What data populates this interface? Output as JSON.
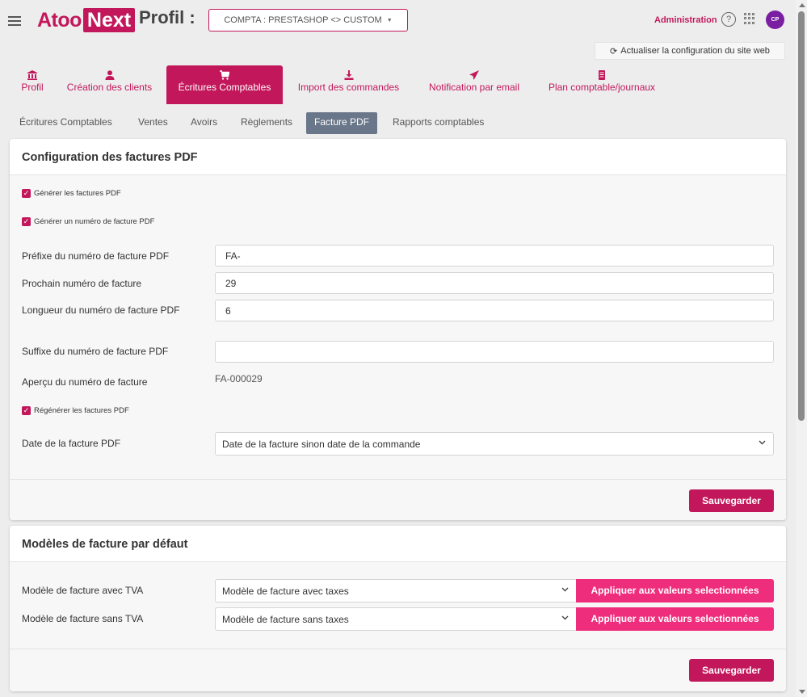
{
  "header": {
    "logo_part1": "Atoo",
    "logo_part2": "Next",
    "title": "Profil :",
    "company_select": "COMPTA : PRESTASHOP <> CUSTOM",
    "admin_link": "Administration",
    "help": "?",
    "avatar": "CP",
    "refresh": "Actualiser la configuration du site web"
  },
  "main_tabs": [
    {
      "label": "Profil",
      "icon": "bank-icon",
      "glyph": "🏛"
    },
    {
      "label": "Création des clients",
      "icon": "user-icon",
      "glyph": "👤"
    },
    {
      "label": "Écritures Comptables",
      "icon": "cart-icon",
      "glyph": "🛒"
    },
    {
      "label": "Import des commandes",
      "icon": "download-icon",
      "glyph": "⬇"
    },
    {
      "label": "Notification par email",
      "icon": "paper-plane-icon",
      "glyph": "➤"
    },
    {
      "label": "Plan comptable/journaux",
      "icon": "book-icon",
      "glyph": "▤"
    }
  ],
  "sub_tabs": [
    {
      "label": "Écritures Comptables"
    },
    {
      "label": "Ventes"
    },
    {
      "label": "Avoirs"
    },
    {
      "label": "Règlements"
    },
    {
      "label": "Facture PDF"
    },
    {
      "label": "Rapports comptables"
    }
  ],
  "pdf_config": {
    "title": "Configuration des factures PDF",
    "cb_generate": "Générer les factures PDF",
    "cb_number": "Générer un numéro de facture PDF",
    "prefix_label": "Préfixe du numéro de facture PDF",
    "prefix_value": "FA-",
    "next_label": "Prochain numéro de facture",
    "next_value": "29",
    "length_label": "Longueur du numéro de facture PDF",
    "length_value": "6",
    "suffix_label": "Suffixe du numéro de facture PDF",
    "suffix_value": "",
    "preview_label": "Aperçu du numéro de facture",
    "preview_value": "FA-000029",
    "cb_regenerate": "Régénérer les factures PDF",
    "date_label": "Date de la facture PDF",
    "date_value": "Date de la facture sinon date de la commande",
    "save": "Sauvegarder"
  },
  "templates": {
    "title": "Modèles de facture par défaut",
    "vat_label": "Modèle de facture avec TVA",
    "vat_value": "Modèle de facture avec taxes",
    "novat_label": "Modèle de facture sans TVA",
    "novat_value": "Modèle de facture sans taxes",
    "apply": "Appliquer aux valeurs selectionnées",
    "save": "Sauvegarder"
  },
  "colors": {
    "brand": "#c2185b",
    "apply": "#ef2d7d",
    "active_subtab": "#6a7689",
    "avatar": "#7b1fa2"
  }
}
